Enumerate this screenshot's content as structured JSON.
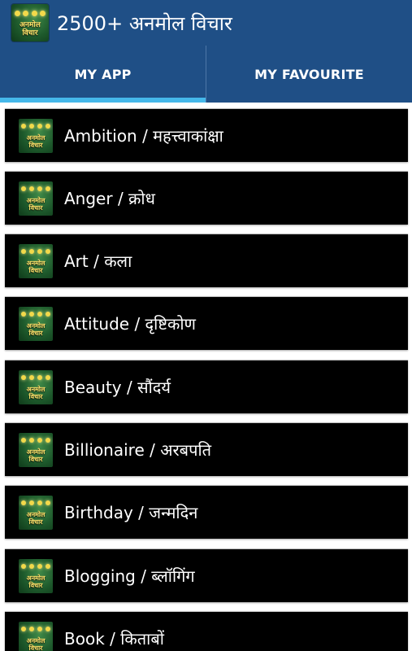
{
  "app": {
    "title": "2500+ अनमोल विचार",
    "logo_text_line1": "अनमोल",
    "logo_text_line2": "विचार",
    "logo_icon": "light-bulbs-logo"
  },
  "tabs": [
    {
      "label": "MY APP",
      "selected": true
    },
    {
      "label": "MY FAVOURITE",
      "selected": false
    }
  ],
  "colors": {
    "app_bar": "#1f4f86",
    "tab_indicator": "#45b8ea",
    "row_background": "#000000",
    "row_text": "#ffffff"
  },
  "categories": [
    {
      "label": "Ambition / महत्त्वाकांक्षा"
    },
    {
      "label": "Anger / क्रोध"
    },
    {
      "label": "Art / कला"
    },
    {
      "label": "Attitude / दृष्टिकोण"
    },
    {
      "label": "Beauty / सौंदर्य"
    },
    {
      "label": "Billionaire / अरबपति"
    },
    {
      "label": "Birthday / जन्मदिन"
    },
    {
      "label": "Blogging / ब्लॉगिंग"
    },
    {
      "label": "Book / किताबों"
    }
  ]
}
